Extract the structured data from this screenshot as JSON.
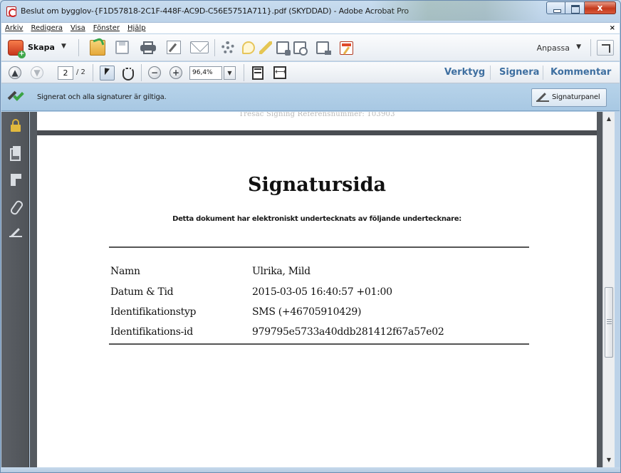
{
  "window": {
    "title": "Beslut om bygglov-{F1D57818-2C1F-448F-AC9D-C56E5751A711}.pdf (SKYDDAD) - Adobe Acrobat Pro",
    "minimize_icon": "minimize-icon",
    "maximize_icon": "maximize-icon",
    "close_label": "x"
  },
  "menubar": {
    "items": [
      "Arkiv",
      "Redigera",
      "Visa",
      "Fönster",
      "Hjälp"
    ],
    "close_label": "×"
  },
  "toolbar": {
    "create_label": "Skapa",
    "create_caret": "▼",
    "customize_label": "Anpassa",
    "customize_caret": "▼",
    "icons": [
      "create-icon",
      "open-icon",
      "save-icon",
      "print-icon",
      "edit-icon",
      "mail-icon",
      "gear-icon",
      "comment-icon",
      "highlight-icon",
      "stamp-icon",
      "compare-icon",
      "export-icon",
      "form-icon",
      "expand-icon"
    ]
  },
  "navbar": {
    "page_current": "2",
    "page_total": "/ 2",
    "zoom": "96,4%",
    "zoom_caret": "▼",
    "prev_glyph": "▲",
    "next_glyph": "▼",
    "zoom_out_glyph": "−",
    "zoom_in_glyph": "+",
    "tools_label": "Verktyg",
    "sign_label": "Signera",
    "comment_label": "Kommentar"
  },
  "signature_bar": {
    "message": "Signerat och alla signaturer är giltiga.",
    "panel_button_label": "Signaturpanel"
  },
  "document": {
    "previous_page_tail_text": "Tresac Signing Referensnummer: 103903",
    "title": "Signatursida",
    "subtitle": "Detta dokument har elektroniskt undertecknats av följande undertecknare:",
    "rows": [
      {
        "label": "Namn",
        "value": "Ulrika, Mild"
      },
      {
        "label": "Datum & Tid",
        "value": "2015-03-05 16:40:57 +01:00"
      },
      {
        "label": "Identifikationstyp",
        "value": "SMS (+46705910429)"
      },
      {
        "label": "Identifikations-id",
        "value": "979795e5733a40ddb281412f67a57e02"
      }
    ]
  },
  "scrollbar": {
    "up_glyph": "▲",
    "down_glyph": "▼"
  },
  "colors": {
    "pane_link": "#3e6fa0",
    "signature_bar": "#b7d3ea",
    "nav_pane": "#5c6066",
    "close_button": "#c43a1c"
  }
}
